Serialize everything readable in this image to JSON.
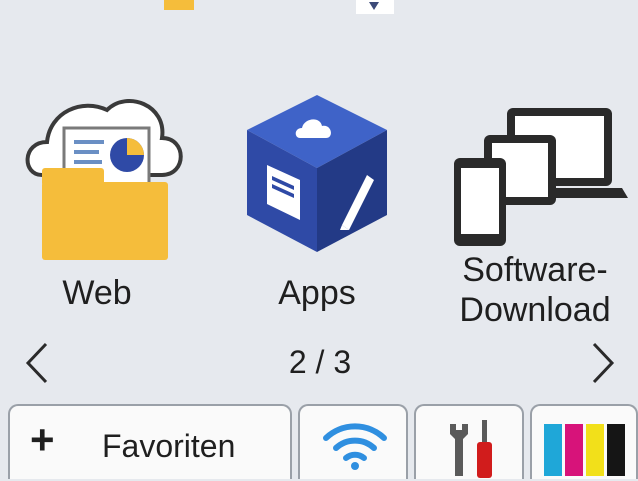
{
  "home": {
    "tiles": [
      {
        "label": "Web",
        "icon": "web-folder-cloud-icon"
      },
      {
        "label": "Apps",
        "icon": "apps-cube-icon"
      },
      {
        "label": "Software-\nDownload",
        "label_line1": "Software-",
        "label_line2": "Download",
        "icon": "devices-icon"
      }
    ],
    "pager": {
      "current": "2 / 3",
      "prev_icon": "chevron-left-icon",
      "next_icon": "chevron-right-icon"
    }
  },
  "bottom_bar": {
    "favorites_label": "Favoriten",
    "favorites_icon": "plus-icon",
    "wifi_icon": "wifi-icon",
    "tools_icon": "wrench-screwdriver-icon",
    "ink_icon": "ink-cartridges-icon"
  },
  "colors": {
    "background": "#e6e9ee",
    "folder": "#f5bd3b",
    "cube": "#2f4aa6",
    "ink_cyan": "#1fa7d8",
    "ink_magenta": "#d7137a",
    "ink_yellow": "#f2e01a",
    "ink_black": "#151515",
    "wifi": "#2f8fe0"
  }
}
